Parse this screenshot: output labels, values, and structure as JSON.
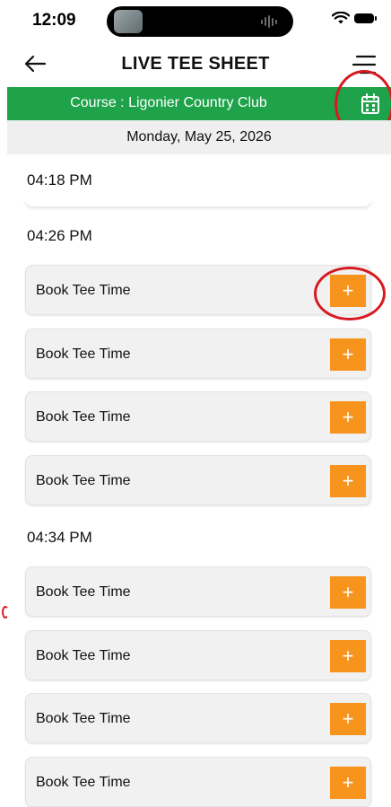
{
  "status_bar": {
    "time": "12:09"
  },
  "header": {
    "title": "LIVE TEE SHEET"
  },
  "course": {
    "label": "Course : Ligonier Country Club"
  },
  "date": {
    "label": "Monday, May 25, 2026"
  },
  "colors": {
    "green": "#1ea34a",
    "orange": "#f7941d",
    "annotation_red": "#d71920"
  },
  "icons": [
    "back-arrow-icon",
    "menu-icon",
    "calendar-icon",
    "plus-icon"
  ],
  "groups": [
    {
      "time": "04:18 PM",
      "slots": []
    },
    {
      "time": "04:26 PM",
      "slots": [
        "Book Tee Time",
        "Book Tee Time",
        "Book Tee Time",
        "Book Tee Time"
      ]
    },
    {
      "time": "04:34 PM",
      "slots": [
        "Book Tee Time",
        "Book Tee Time",
        "Book Tee Time",
        "Book Tee Time"
      ]
    }
  ]
}
